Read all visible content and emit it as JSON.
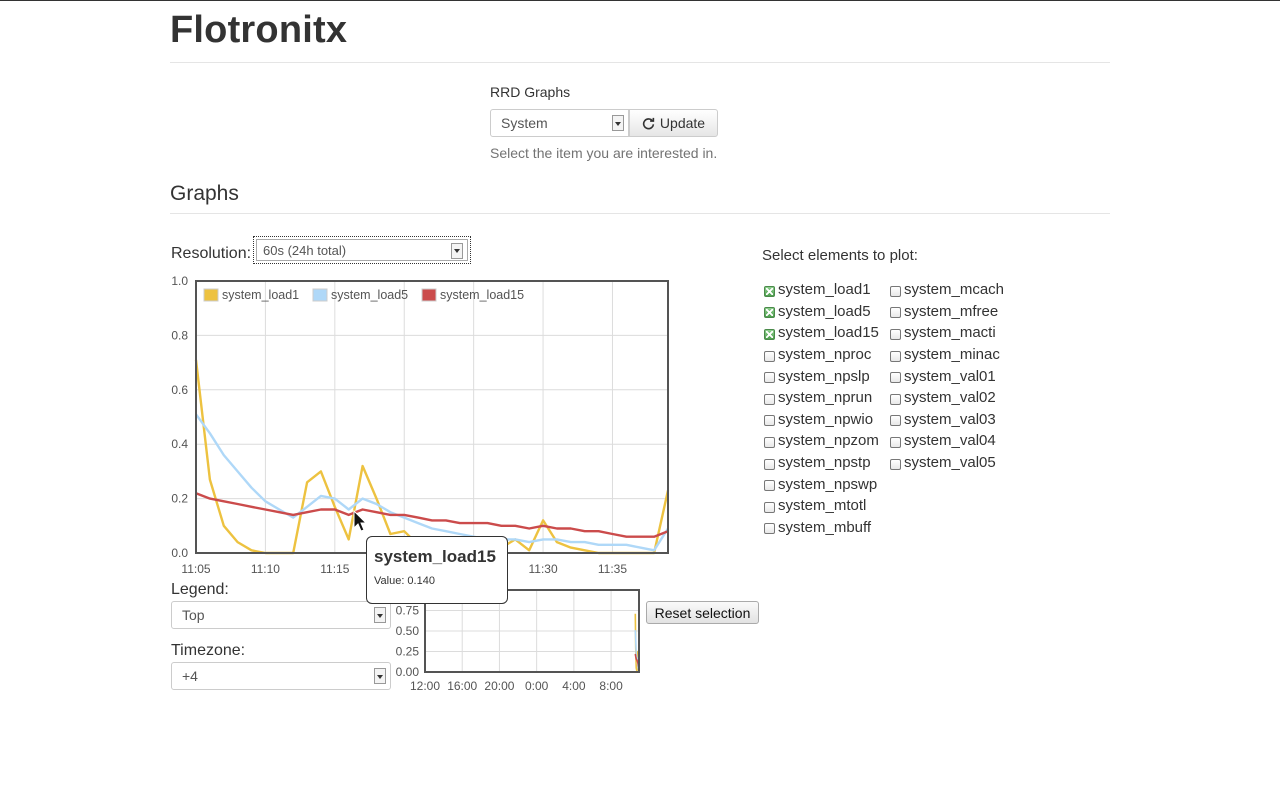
{
  "brand": "Flotronitx",
  "rrd": {
    "label": "RRD Graphs",
    "selected": "System",
    "update_label": "Update",
    "help": "Select the item you are interested in."
  },
  "graphs_title": "Graphs",
  "resolution": {
    "label": "Resolution:",
    "selected": "60s (24h total)"
  },
  "legend_select": {
    "label": "Legend:",
    "selected": "Top"
  },
  "timezone_select": {
    "label": "Timezone:",
    "selected": "+4"
  },
  "reset_label": "Reset selection",
  "tooltip": {
    "title": "system_load15",
    "value_text": "Value: 0.140"
  },
  "elements": {
    "title": "Select elements to plot:",
    "col1": [
      {
        "label": "system_load1",
        "checked": true
      },
      {
        "label": "system_load5",
        "checked": true
      },
      {
        "label": "system_load15",
        "checked": true
      },
      {
        "label": "system_nproc",
        "checked": false
      },
      {
        "label": "system_npslp",
        "checked": false
      },
      {
        "label": "system_nprun",
        "checked": false
      },
      {
        "label": "system_npwio",
        "checked": false
      },
      {
        "label": "system_npzom",
        "checked": false
      },
      {
        "label": "system_npstp",
        "checked": false
      },
      {
        "label": "system_npswp",
        "checked": false
      },
      {
        "label": "system_mtotl",
        "checked": false
      },
      {
        "label": "system_mbuff",
        "checked": false
      }
    ],
    "col2": [
      {
        "label": "system_mcach",
        "checked": false
      },
      {
        "label": "system_mfree",
        "checked": false
      },
      {
        "label": "system_macti",
        "checked": false
      },
      {
        "label": "system_minac",
        "checked": false
      },
      {
        "label": "system_val01",
        "checked": false
      },
      {
        "label": "system_val02",
        "checked": false
      },
      {
        "label": "system_val03",
        "checked": false
      },
      {
        "label": "system_val04",
        "checked": false
      },
      {
        "label": "system_val05",
        "checked": false
      }
    ]
  },
  "colors": {
    "load1": "#edc240",
    "load5": "#afd8f8",
    "load15": "#cb4b4b"
  },
  "chart_data": [
    {
      "type": "line",
      "ylim": [
        0,
        1.0
      ],
      "yticks": [
        0.0,
        0.2,
        0.4,
        0.6,
        0.8,
        1.0
      ],
      "ytick_labels": [
        "0.0",
        "0.2",
        "0.4",
        "0.6",
        "0.8",
        "1.0"
      ],
      "xlim": [
        665,
        699
      ],
      "xticks": [
        665,
        670,
        675,
        680,
        685,
        690,
        695
      ],
      "xtick_labels": [
        "11:05",
        "11:10",
        "11:15",
        "11:20",
        "11:25",
        "11:30",
        "11:35"
      ],
      "legend_position": "top-left",
      "grid": true,
      "x": [
        665,
        666,
        667,
        668,
        669,
        670,
        671,
        672,
        673,
        674,
        675,
        676,
        677,
        678,
        679,
        680,
        681,
        682,
        683,
        684,
        685,
        686,
        687,
        688,
        689,
        690,
        691,
        692,
        693,
        694,
        695,
        696,
        697,
        698,
        699
      ],
      "series": [
        {
          "name": "system_load1",
          "color": "#edc240",
          "values": [
            0.71,
            0.27,
            0.1,
            0.04,
            0.01,
            0.0,
            0.0,
            0.0,
            0.26,
            0.3,
            0.17,
            0.05,
            0.32,
            0.2,
            0.07,
            0.08,
            0.03,
            0.02,
            0.01,
            0.02,
            0.04,
            0.01,
            0.02,
            0.05,
            0.01,
            0.12,
            0.04,
            0.02,
            0.01,
            0.0,
            0.0,
            0.0,
            0.0,
            0.0,
            0.23
          ]
        },
        {
          "name": "system_load5",
          "color": "#afd8f8",
          "values": [
            0.51,
            0.44,
            0.36,
            0.3,
            0.24,
            0.19,
            0.16,
            0.13,
            0.17,
            0.21,
            0.2,
            0.16,
            0.2,
            0.18,
            0.15,
            0.13,
            0.11,
            0.09,
            0.08,
            0.07,
            0.06,
            0.05,
            0.05,
            0.05,
            0.04,
            0.05,
            0.05,
            0.04,
            0.04,
            0.03,
            0.03,
            0.03,
            0.02,
            0.01,
            0.09
          ]
        },
        {
          "name": "system_load15",
          "color": "#cb4b4b",
          "values": [
            0.22,
            0.2,
            0.19,
            0.18,
            0.17,
            0.16,
            0.15,
            0.14,
            0.15,
            0.16,
            0.16,
            0.14,
            0.16,
            0.15,
            0.14,
            0.14,
            0.13,
            0.12,
            0.12,
            0.11,
            0.11,
            0.11,
            0.1,
            0.1,
            0.09,
            0.1,
            0.09,
            0.09,
            0.08,
            0.08,
            0.07,
            0.06,
            0.06,
            0.06,
            0.08
          ]
        }
      ]
    },
    {
      "type": "line",
      "ylim": [
        0,
        1.0
      ],
      "yticks": [
        0.0,
        0.25,
        0.5,
        0.75
      ],
      "ytick_labels": [
        "0.00",
        "0.25",
        "0.50",
        "0.75"
      ],
      "xlim": [
        0,
        23
      ],
      "xticks": [
        0,
        4,
        8,
        12,
        16,
        20
      ],
      "xtick_labels": [
        "12:00",
        "16:00",
        "20:00",
        "0:00",
        "4:00",
        "8:00"
      ],
      "grid": true,
      "x": [
        22.6,
        22.65,
        22.7,
        22.75,
        22.8,
        22.85,
        22.9,
        22.95,
        23.0
      ],
      "series": [
        {
          "name": "system_load1",
          "color": "#edc240",
          "values": [
            0.71,
            0.3,
            0.05,
            0.02,
            0.25,
            0.2,
            0.05,
            0.01,
            0.23
          ]
        },
        {
          "name": "system_load5",
          "color": "#afd8f8",
          "values": [
            0.51,
            0.4,
            0.22,
            0.18,
            0.17,
            0.1,
            0.06,
            0.03,
            0.09
          ]
        },
        {
          "name": "system_load15",
          "color": "#cb4b4b",
          "values": [
            0.22,
            0.19,
            0.16,
            0.15,
            0.14,
            0.12,
            0.1,
            0.07,
            0.08
          ]
        }
      ]
    }
  ]
}
